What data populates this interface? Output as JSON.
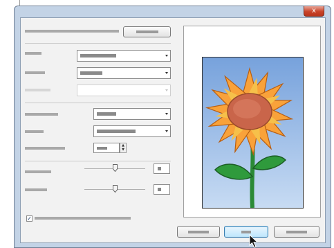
{
  "window": {
    "close_glyph": "x",
    "close_button_color": "#c9442a",
    "title_bar_color": "#c3d3e6"
  },
  "checkbox": {
    "checked": true,
    "glyph": "✓"
  },
  "sliders": [
    {
      "level": 0.5
    },
    {
      "level": 0.5
    }
  ],
  "preview": {
    "image": "sunflower-illustration",
    "colors": {
      "sky": "#77a2dc",
      "petals": "#f9a23a",
      "center": "#c9654a",
      "stem": "#2f9a3c"
    }
  },
  "icons": [
    "close-icon",
    "dropdown-arrow-icon",
    "spin-up-icon",
    "spin-down-icon",
    "slider-thumb-icon",
    "checkmark-icon",
    "mouse-cursor-icon"
  ]
}
